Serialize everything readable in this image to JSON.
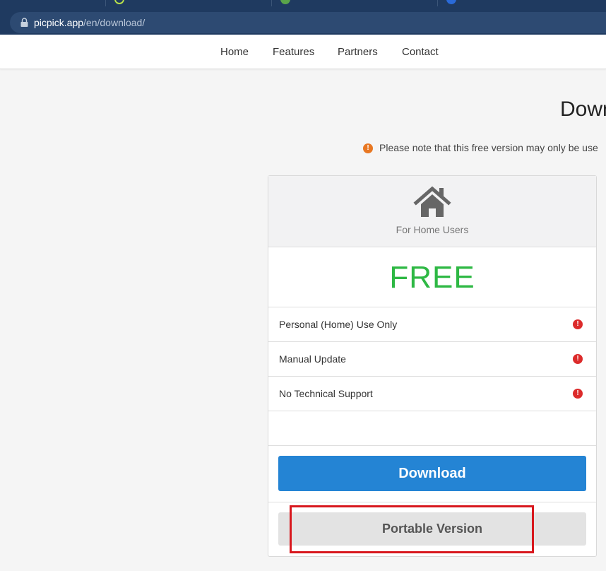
{
  "browser": {
    "url_host": "picpick.app",
    "url_path": "/en/download/",
    "lock_icon": "lock-icon"
  },
  "nav": {
    "items": [
      {
        "label": "Home"
      },
      {
        "label": "Features"
      },
      {
        "label": "Partners"
      },
      {
        "label": "Contact"
      }
    ]
  },
  "page": {
    "title": "Down",
    "note_icon": "info-icon",
    "note": "Please note that this free version may only be use"
  },
  "plan": {
    "icon": "home-icon",
    "label": "For Home Users",
    "price": "FREE",
    "features": [
      {
        "text": "Personal (Home) Use Only",
        "icon": "alert-icon"
      },
      {
        "text": "Manual Update",
        "icon": "alert-icon"
      },
      {
        "text": "No Technical Support",
        "icon": "alert-icon"
      }
    ],
    "download_label": "Download",
    "portable_label": "Portable Version"
  },
  "colors": {
    "chrome": "#1f3a60",
    "price_green": "#2eb844",
    "download_blue": "#2484d4",
    "alert_red": "#dc2b2b",
    "note_orange": "#e87722",
    "highlight_red": "#d8171d"
  }
}
